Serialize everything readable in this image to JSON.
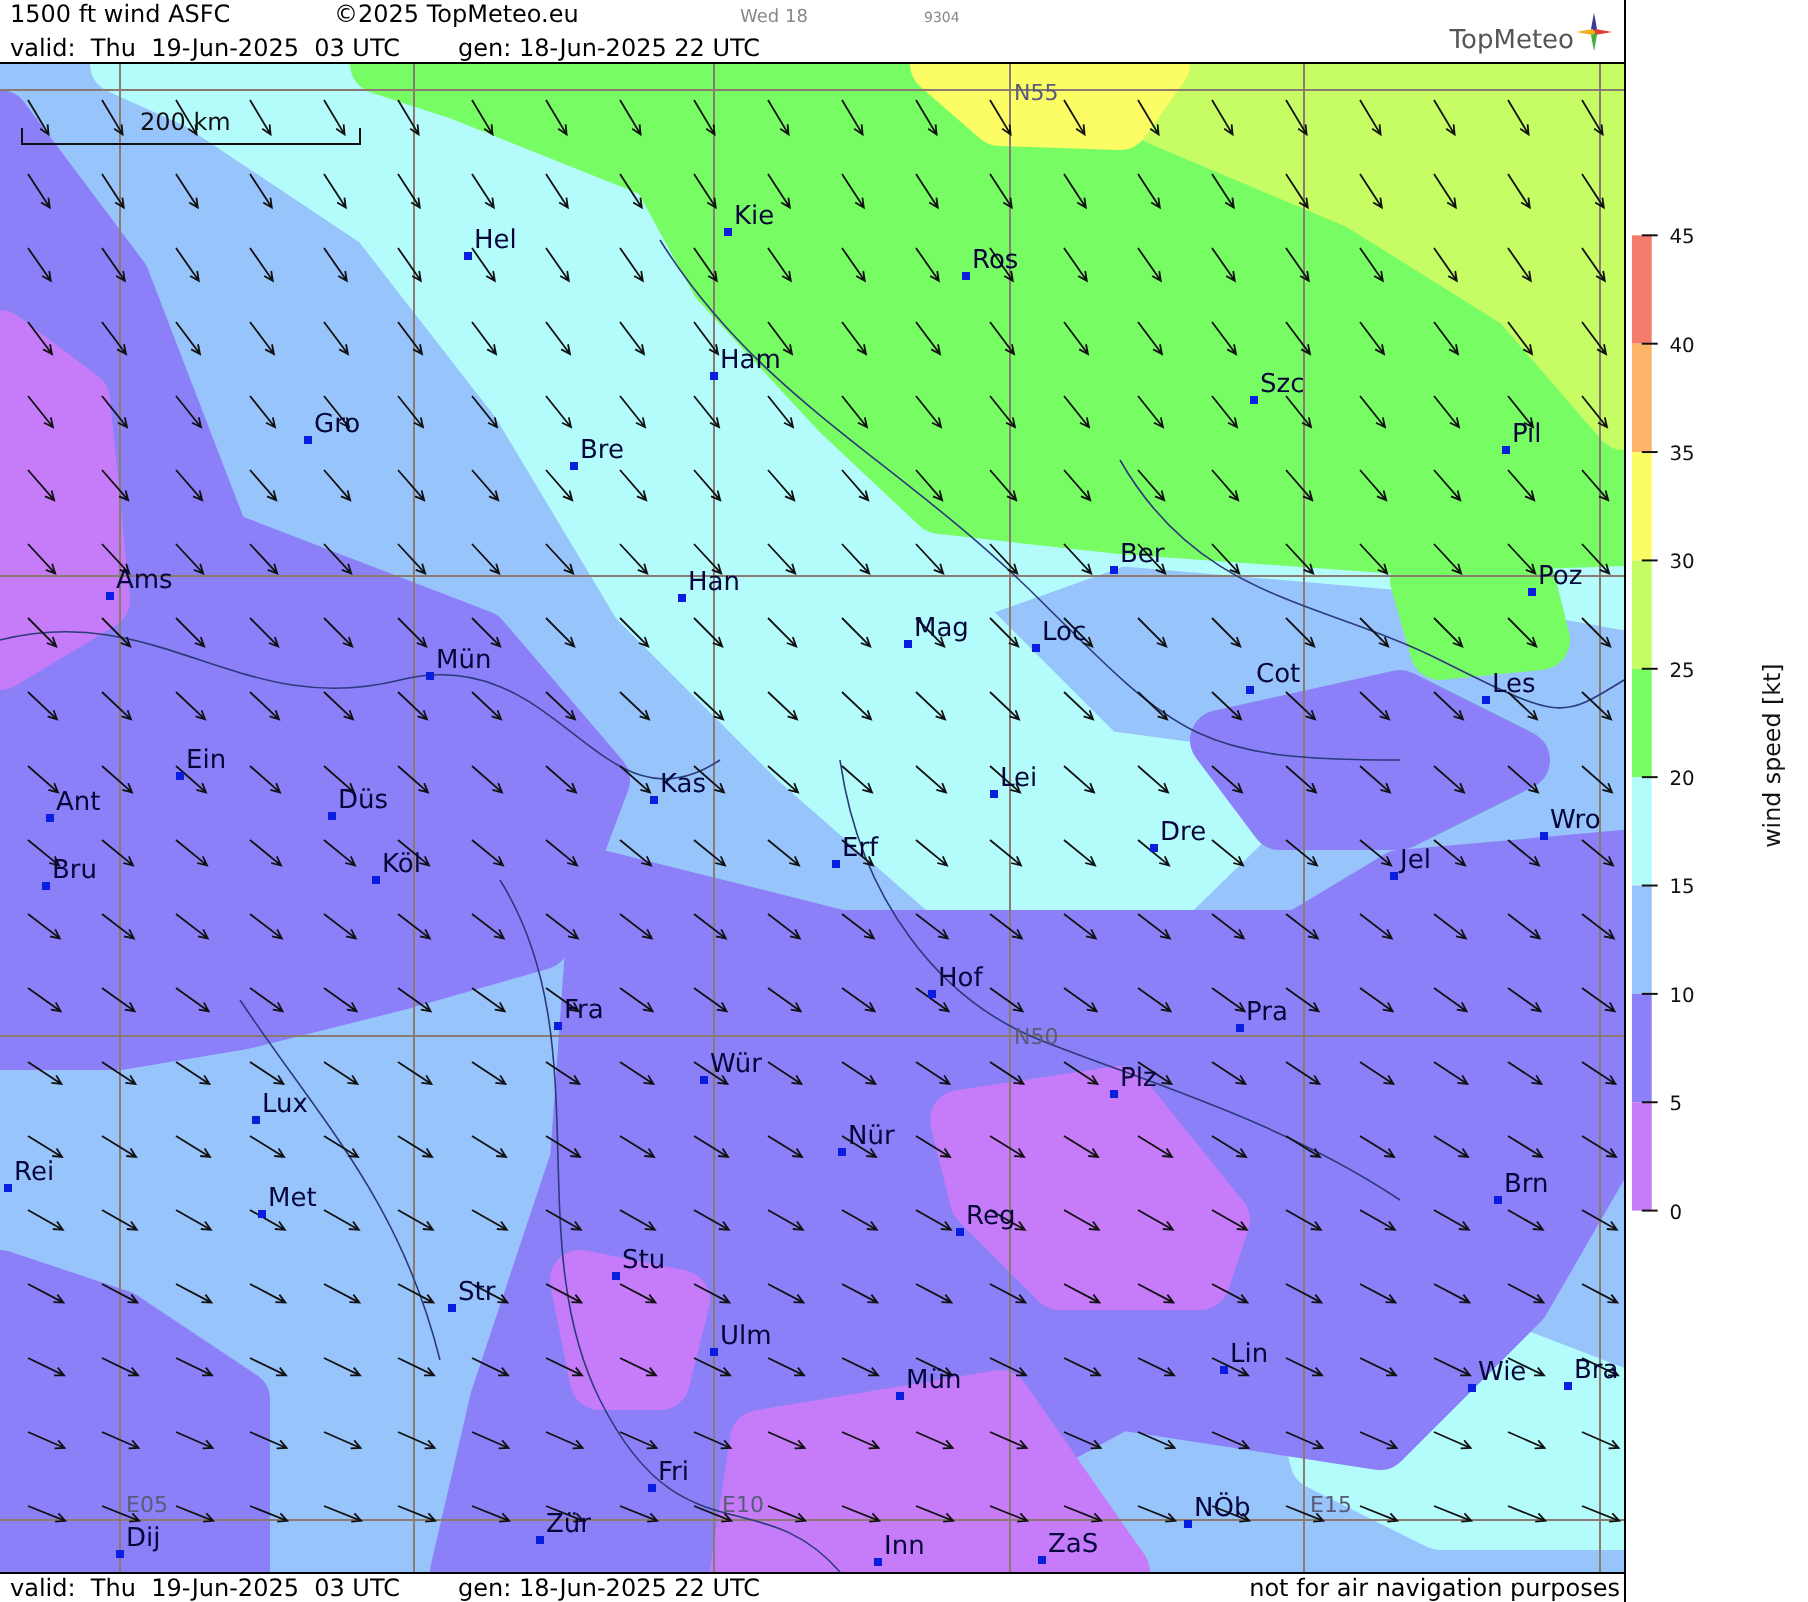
{
  "header": {
    "title": "1500 ft wind ASFC",
    "copyright": "©2025 TopMeteo.eu",
    "day": "Wed 18",
    "code": "9304",
    "valid": "valid:  Thu  19-Jun-2025  03 UTC",
    "generated": "gen: 18-Jun-2025 22 UTC",
    "logo": "TopMeteo"
  },
  "map": {
    "scale": "200 km",
    "grid_labels": [
      "N55",
      "N50",
      "E05",
      "E10",
      "E15"
    ],
    "cities": [
      "Hel",
      "Kie",
      "Ros",
      "Ham",
      "Szc",
      "Gro",
      "Bre",
      "Pil",
      "Ams",
      "Han",
      "Ber",
      "Poz",
      "Mag",
      "Loc",
      "Mün",
      "Cot",
      "Les",
      "Ein",
      "Kas",
      "Lei",
      "Ant",
      "Düs",
      "Wro",
      "Erf",
      "Dre",
      "Bru",
      "Köl",
      "Jel",
      "Hof",
      "Fra",
      "Pra",
      "Wür",
      "Plz",
      "Lux",
      "Nür",
      "Rei",
      "Met",
      "Brn",
      "Reg",
      "Stu",
      "Str",
      "Ulm",
      "Lin",
      "Mün",
      "Wie",
      "Bra",
      "Fri",
      "NÖb",
      "Dij",
      "Zür",
      "Inn",
      "ZaS"
    ]
  },
  "legend": {
    "title": "wind speed [kt]",
    "ticks": [
      "45",
      "40",
      "35",
      "30",
      "25",
      "20",
      "15",
      "10",
      "5",
      "0"
    ],
    "bands": [
      {
        "color": "#f47c6c"
      },
      {
        "color": "#fcb468"
      },
      {
        "color": "#fcfc64"
      },
      {
        "color": "#c6fc64"
      },
      {
        "color": "#78fc64"
      },
      {
        "color": "#b4fcfc"
      },
      {
        "color": "#98c4fc"
      },
      {
        "color": "#8c80f8"
      },
      {
        "color": "#c67cf8"
      }
    ]
  },
  "footer": {
    "valid": "valid:  Thu  19-Jun-2025  03 UTC",
    "generated": "gen: 18-Jun-2025 22 UTC",
    "notice": "not for air navigation purposes"
  }
}
